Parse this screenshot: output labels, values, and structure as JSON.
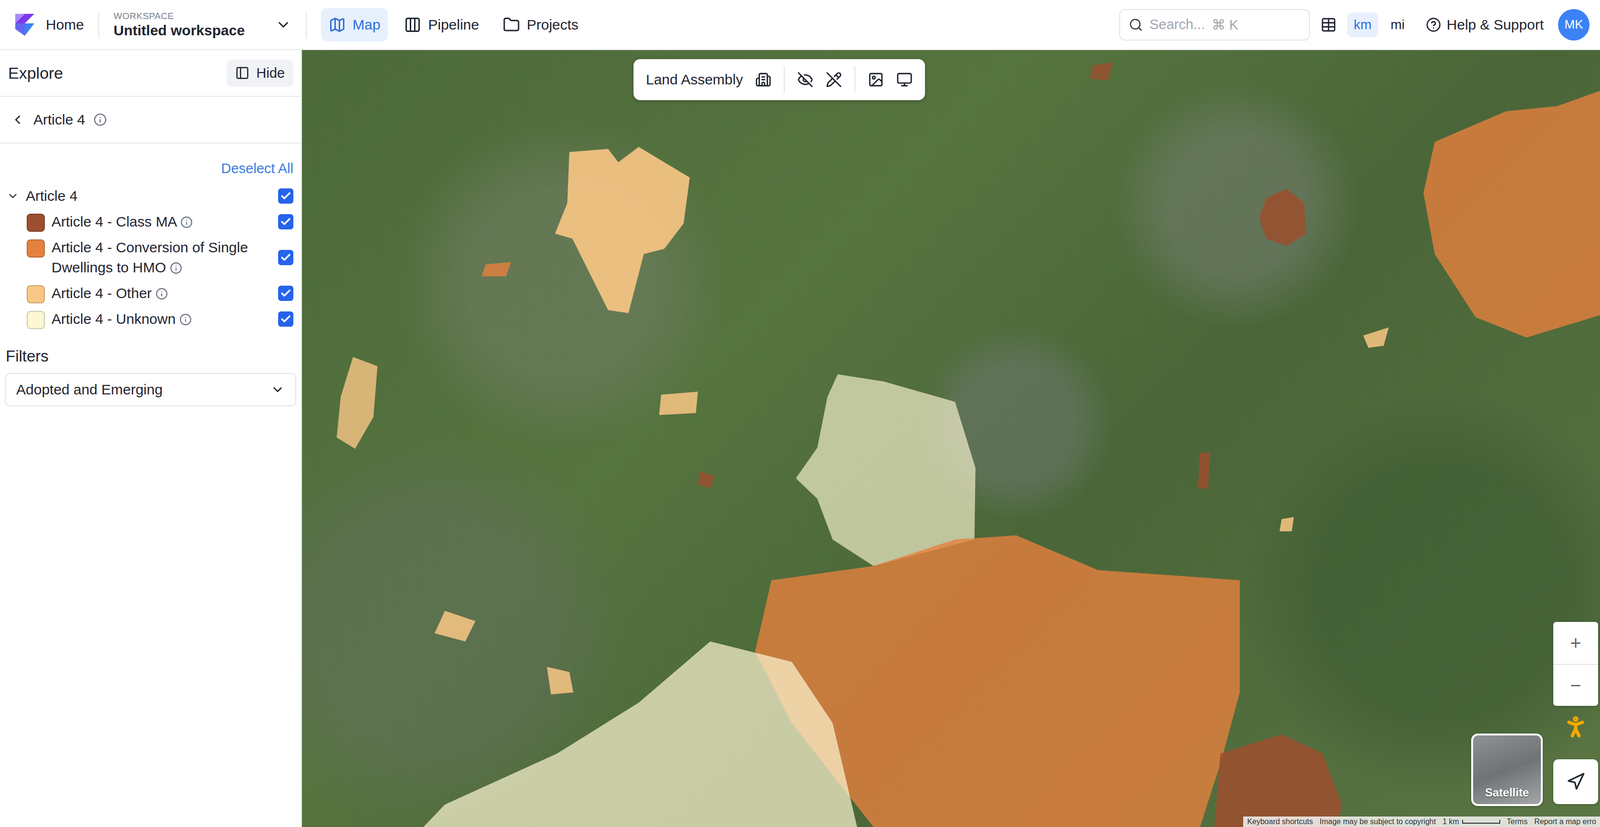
{
  "topbar": {
    "home": "Home",
    "workspace_label": "WORKSPACE",
    "workspace": "Untitled workspace",
    "nav": [
      {
        "label": "Map",
        "selected": true
      },
      {
        "label": "Pipeline",
        "selected": false
      },
      {
        "label": "Projects",
        "selected": false
      }
    ],
    "search": {
      "placeholder": "Search...",
      "shortcut": "⌘ K"
    },
    "units": [
      {
        "label": "km",
        "selected": true
      },
      {
        "label": "mi",
        "selected": false
      }
    ],
    "help": "Help & Support",
    "avatar": "MK"
  },
  "sidebar": {
    "title": "Explore",
    "hide": "Hide",
    "back": "Article 4",
    "deselect": "Deselect All",
    "group": {
      "label": "Article 4",
      "expanded": true,
      "checked": true
    },
    "layers": [
      {
        "label": "Article 4 - Class MA",
        "checked": true,
        "color": "#9c4f2e"
      },
      {
        "label": "Article 4 - Conversion of Single Dwellings to HMO",
        "checked": true,
        "color": "#e5813f"
      },
      {
        "label": "Article 4 - Other",
        "checked": true,
        "color": "#f9c785"
      },
      {
        "label": "Article 4 - Unknown",
        "checked": true,
        "color": "#fdf7d2"
      }
    ],
    "filters_title": "Filters",
    "filter": "Adopted and Emerging"
  },
  "map": {
    "toolbar": "Land Assembly",
    "zoom_in": "+",
    "zoom_out": "−",
    "basemap": "Satellite",
    "footer": {
      "shortcuts": "Keyboard shortcuts",
      "copyright": "Image may be subject to copyright",
      "scale": "1 km",
      "terms": "Terms",
      "report": "Report a map erro"
    }
  }
}
